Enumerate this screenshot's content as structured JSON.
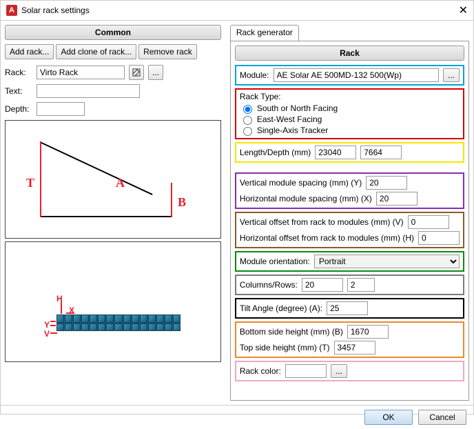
{
  "window": {
    "title": "Solar rack settings"
  },
  "common": {
    "header": "Common",
    "add_rack": "Add rack...",
    "add_clone": "Add clone of rack...",
    "remove_rack": "Remove rack",
    "rack_label": "Rack:",
    "rack_value": "Virto Rack",
    "text_label": "Text:",
    "text_value": "",
    "depth_label": "Depth:",
    "depth_value": ""
  },
  "diagram1": {
    "T": "T",
    "A": "A",
    "B": "B"
  },
  "diagram2": {
    "H": "H",
    "X": "X",
    "Y": "Y",
    "V": "V"
  },
  "tabs": {
    "generator": "Rack generator"
  },
  "rack": {
    "header": "Rack",
    "module_label": "Module:",
    "module_value": "AE Solar AE 500MD-132 500(Wp)",
    "module_browse": "...",
    "rack_type_label": "Rack Type:",
    "rt_south": "South or North Facing",
    "rt_ew": "East-West Facing",
    "rt_tracker": "Single-Axis Tracker",
    "length_label": "Length/Depth (mm)",
    "length_val": "23040",
    "depth_val": "7664",
    "vspacing_label": "Vertical module spacing (mm) (Y)",
    "vspacing_val": "20",
    "hspacing_label": "Horizontal module spacing (mm) (X)",
    "hspacing_val": "20",
    "voff_label": "Vertical offset from rack to modules (mm) (V)",
    "voff_val": "0",
    "hoff_label": "Horizontal offset from rack to modules (mm) (H)",
    "hoff_val": "0",
    "orient_label": "Module orientation:",
    "orient_val": "Portrait",
    "colrow_label": "Columns/Rows:",
    "cols_val": "20",
    "rows_val": "2",
    "tilt_label": "Tilt Angle (degree) (A):",
    "tilt_val": "25",
    "bottom_label": "Bottom side height (mm) (B)",
    "bottom_val": "1670",
    "top_label": "Top side height (mm) (T)",
    "top_val": "3457",
    "color_label": "Rack color:",
    "color_browse": "..."
  },
  "footer": {
    "ok": "OK",
    "cancel": "Cancel"
  }
}
